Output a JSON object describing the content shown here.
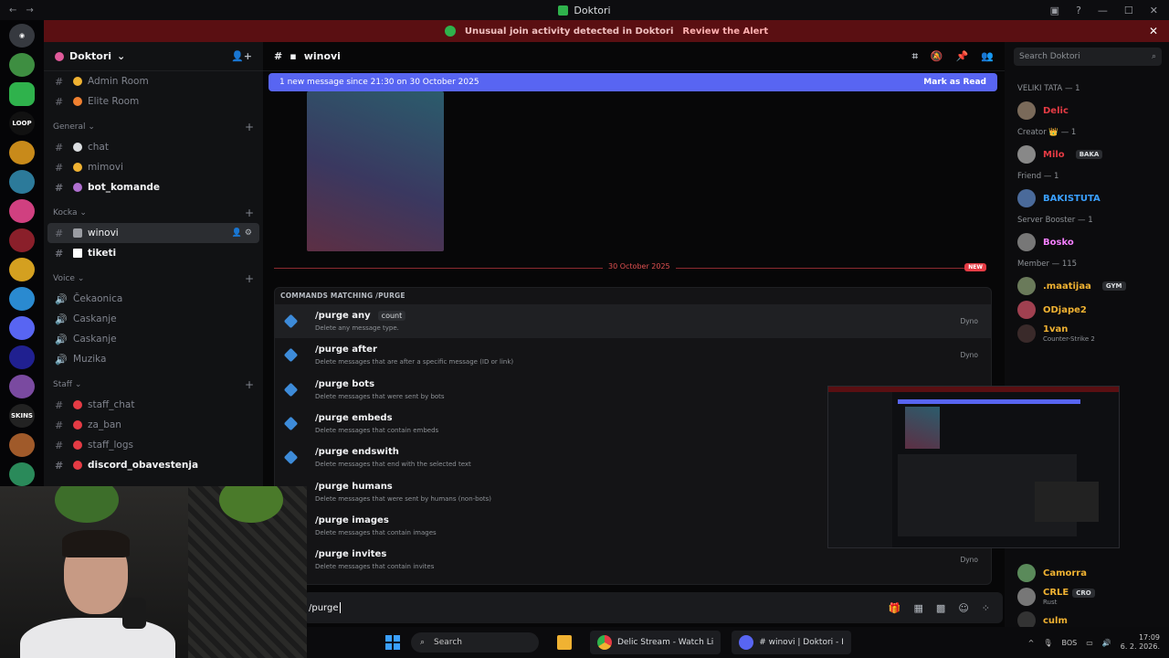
{
  "window": {
    "title": "Doktori",
    "controls": [
      "—",
      "☐",
      "✕"
    ]
  },
  "alert": {
    "text": "Unusual join activity detected in Doktori",
    "action": "Review the Alert",
    "close": "✕"
  },
  "server": {
    "name": "Doktori"
  },
  "sidebar": {
    "top_channels": [
      {
        "label": "Admin Room",
        "icon": "#"
      },
      {
        "label": "Elite Room",
        "icon": "#"
      }
    ],
    "categories": [
      {
        "name": "General",
        "channels": [
          {
            "label": "chat",
            "bold": false
          },
          {
            "label": "mimovi",
            "bold": false
          },
          {
            "label": "bot_komande",
            "bold": true
          }
        ]
      },
      {
        "name": "Kocka",
        "channels": [
          {
            "label": "winovi",
            "active": true
          },
          {
            "label": "tiketi",
            "bold": true
          }
        ]
      },
      {
        "name": "Voice",
        "channels": [
          {
            "label": "Čekaonica"
          },
          {
            "label": "Caskanje"
          },
          {
            "label": "Caskanje"
          },
          {
            "label": "Muzika"
          }
        ]
      },
      {
        "name": "Staff",
        "channels": [
          {
            "label": "staff_chat"
          },
          {
            "label": "za_ban"
          },
          {
            "label": "staff_logs"
          },
          {
            "label": "discord_obavestenja",
            "bold": true
          }
        ]
      }
    ]
  },
  "channel": {
    "name": "winovi"
  },
  "new_message_bar": {
    "text": "1 new message since 21:30 on 30 October 2025",
    "action": "Mark as Read"
  },
  "divider": {
    "date": "30 October 2025",
    "badge": "NEW"
  },
  "commands": {
    "header": "COMMANDS MATCHING /PURGE",
    "items": [
      {
        "name": "/purge any",
        "option": "count",
        "desc": "Delete any message type.",
        "source": "Dyno"
      },
      {
        "name": "/purge after",
        "option": "",
        "desc": "Delete messages that are after a specific message (ID or link)",
        "source": "Dyno"
      },
      {
        "name": "/purge bots",
        "option": "",
        "desc": "Delete messages that were sent by bots",
        "source": ""
      },
      {
        "name": "/purge embeds",
        "option": "",
        "desc": "Delete messages that contain embeds",
        "source": ""
      },
      {
        "name": "/purge endswith",
        "option": "",
        "desc": "Delete messages that end with the selected text",
        "source": ""
      },
      {
        "name": "/purge humans",
        "option": "",
        "desc": "Delete messages that were sent by humans (non-bots)",
        "source": ""
      },
      {
        "name": "/purge images",
        "option": "",
        "desc": "Delete messages that contain images",
        "source": ""
      },
      {
        "name": "/purge invites",
        "option": "",
        "desc": "Delete messages that contain invites",
        "source": "Dyno"
      }
    ]
  },
  "input": {
    "value": "/purge"
  },
  "members": {
    "search_placeholder": "Search Doktori",
    "groups": [
      {
        "title": "VELIKI TATA — 1",
        "members": [
          {
            "name": "Delic",
            "color": "#e53b44"
          }
        ]
      },
      {
        "title": "Creator 👑 — 1",
        "members": [
          {
            "name": "Milo",
            "color": "#e53b44",
            "tag": "BAKA"
          }
        ]
      },
      {
        "title": "Friend — 1",
        "members": [
          {
            "name": "BAKISTUTA",
            "color": "#3aa0ff"
          }
        ]
      },
      {
        "title": "Server Booster — 1",
        "members": [
          {
            "name": "Bosko",
            "color": "#f47fff"
          }
        ]
      },
      {
        "title": "Member — 115",
        "members": [
          {
            "name": ".maatijaa",
            "color": "#f0b232",
            "tag": "GYM"
          },
          {
            "name": "ODjape2",
            "color": "#f0b232"
          },
          {
            "name": "1van",
            "color": "#f0b232",
            "activity": "Counter-Strike 2"
          }
        ]
      }
    ],
    "bottom_members": [
      {
        "name": "Camorra",
        "color": "#f0b232"
      },
      {
        "name": "CRLE",
        "color": "#f0b232",
        "tag": "CRO",
        "activity": "Rust"
      },
      {
        "name": "culm",
        "color": "#f0b232"
      }
    ]
  },
  "taskbar": {
    "search": "Search",
    "apps": [
      {
        "label": "Delic Stream - Watch Li"
      },
      {
        "label": "# winovi | Doktori - I"
      }
    ],
    "lang": "BOS",
    "time": "17:09",
    "date": "6. 2. 2026."
  },
  "colors": {
    "accent": "#5865f2",
    "alert_bg": "#5a0f12",
    "danger": "#e53b44"
  }
}
